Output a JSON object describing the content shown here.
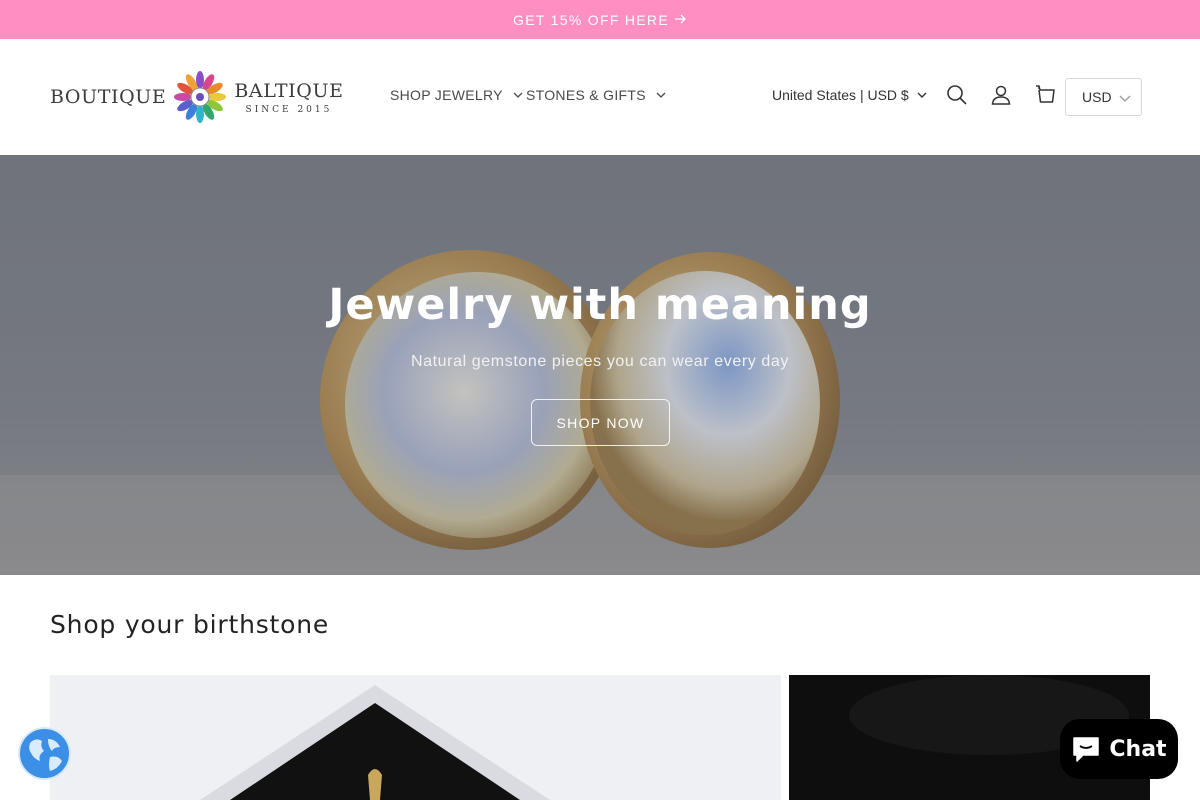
{
  "colors": {
    "announcement_bg": "#ff8ec2",
    "hero_overlay": "#7b7f86",
    "chat_bg": "#000000",
    "globe": "#3b8fe6"
  },
  "announcement": {
    "text": "GET 15% OFF HERE",
    "icon": "arrow-right-icon"
  },
  "header": {
    "logo": {
      "word_left": "BOUTIQUE",
      "word_right": "BALTIQUE",
      "since": "SINCE 2015"
    },
    "nav": [
      {
        "label": "SHOP JEWELRY",
        "icon": "chevron-down-icon"
      },
      {
        "label": "STONES & GIFTS",
        "icon": "chevron-down-icon"
      }
    ],
    "country_selector": "United States | USD $",
    "icons": [
      "search-icon",
      "account-icon",
      "cart-icon"
    ],
    "currency": "USD"
  },
  "hero": {
    "title": "Jewelry with meaning",
    "subtitle": "Natural gemstone pieces you can wear every day",
    "button": "SHOP NOW"
  },
  "birthstone": {
    "title": "Shop your birthstone"
  },
  "widgets": {
    "chat_label": "Chat",
    "globe_icon": "globe-icon",
    "chat_icon": "chat-bubble-icon"
  }
}
